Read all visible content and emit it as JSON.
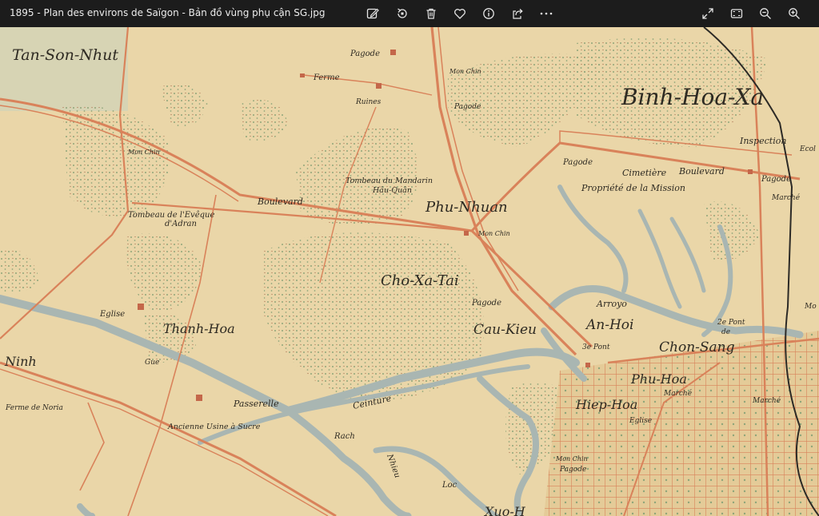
{
  "window": {
    "title": "1895 - Plan des environs de Saïgon - Bản đồ vùng phụ cận SG.jpg"
  },
  "toolbar": {
    "edit_icon": "edit-image-icon",
    "rotate_icon": "rotate-icon",
    "delete_icon": "trash-icon",
    "favorite_icon": "heart-icon",
    "info_icon": "info-icon",
    "share_icon": "share-icon",
    "more_icon": "more-icon",
    "fullscreen_icon": "expand-icon",
    "fit_icon": "fit-window-icon",
    "zoom_out_icon": "zoom-out-icon",
    "zoom_in_icon": "zoom-in-icon"
  },
  "colors": {
    "titlebar_bg": "#1c1c1c",
    "paper": "#ead6a8",
    "road": "#d9825a",
    "water": "#a9b6b2",
    "vegetation": "#8fa57a",
    "ink": "#2e2a22"
  },
  "map": {
    "labels": {
      "tan_son_nhut": "Tan-Son-Nhut",
      "pagode_top": "Pagode",
      "ferme": "Ferme",
      "ruines": "Ruines",
      "mon_chin_top": "Mon Chin",
      "pagode_2": "Pagode",
      "binh_hoa_xa": "Binh-Hoa-Xa",
      "inspection": "Inspection",
      "ecole": "Ecol",
      "mon_chin_left": "Mon Chin",
      "tombeau_mandarin": "Tombeau du Mandarin",
      "hau_quan": "Hâu-Quân",
      "pagode_3": "Pagode",
      "cimetiere": "Cimetière",
      "boulevard_right": "Boulevard",
      "propriete_mission": "Propriété de la Mission",
      "pagode_right": "Pagode",
      "marche_right": "Marché",
      "boulevard_left": "Boulevard",
      "tombeau_eveque": "Tombeau de l'Evêque",
      "d_adran": "d'Adran",
      "phu_nhuan": "Phu-Nhuan",
      "mon_chin_center": "Mon Chin",
      "cho_xa_tai": "Cho-Xa-Tai",
      "pagode_center": "Pagode",
      "eglise_left": "Eglise",
      "thanh_hoa": "Thanh-Hoa",
      "cau_kieu": "Cau-Kieu",
      "arroyo": "Arroyo",
      "an_hoi": "An-Hoi",
      "pont_2": "2e Pont",
      "pont_de": "de",
      "pont_3": "3e Pont",
      "chon_sang": "Chon-Sang",
      "mon_right_edge": "Mo",
      "ninh": "Ninh",
      "gue": "Gue",
      "phu_hoa": "Phu-Hoa",
      "marche_center": "Marché",
      "marche_far": "Marché",
      "ferme_noria": "Ferme de Noria",
      "passerelle": "Passerelle",
      "ceinture": "Ceinture",
      "ancienne_usine": "Ancienne Usine à Sucre",
      "hiep_hoa": "Hiep-Hoa",
      "eglise_right": "Eglise",
      "rach": "Rach",
      "nhieu": "Nhieu",
      "loc": "Loc",
      "mon_chin_bottom": "Mon Chin",
      "pagode_bottom": "Pagode",
      "xuong_partial": "Xuo-H"
    }
  }
}
